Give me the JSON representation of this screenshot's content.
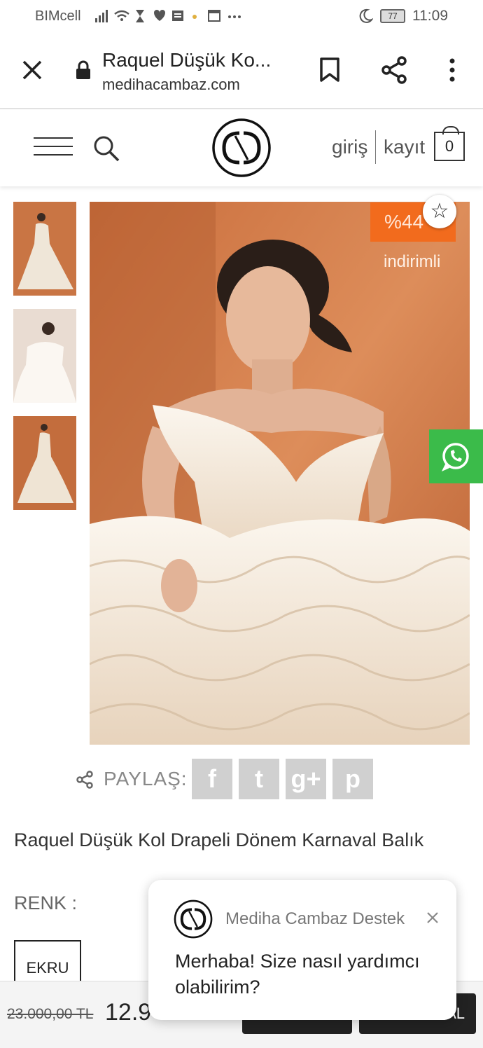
{
  "status_bar": {
    "carrier": "BIMcell",
    "battery": "77",
    "time": "11:09"
  },
  "browser": {
    "page_title": "Raquel Düşük Ko...",
    "url": "medihacambaz.com"
  },
  "header": {
    "login": "giriş",
    "register": "kayıt",
    "cart_count": "0"
  },
  "product": {
    "discount": "%44",
    "discount_label": "indirimli",
    "share_label": "PAYLAŞ:",
    "share_buttons": [
      "f",
      "t",
      "g+",
      "p"
    ],
    "title": "Raquel Düşük Kol Drapeli Dönem Karnaval Balık",
    "color_label": "RENK :",
    "color_option": "EKRU"
  },
  "bottom_bar": {
    "old_price": "23.000,00 TL",
    "new_price": "12.9",
    "button2_label": "AL"
  },
  "chat": {
    "name": "Mediha Cambaz Destek",
    "message": "Merhaba! Size nasıl yardımcı olabilirim?"
  },
  "colors": {
    "accent_orange": "#f26b1d",
    "whatsapp_green": "#3bbb4a",
    "button_dark": "#222222"
  }
}
